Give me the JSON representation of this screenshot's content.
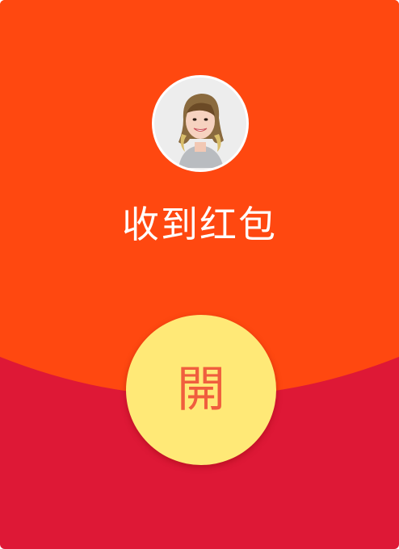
{
  "envelope": {
    "title": "收到红包",
    "open_label": "開",
    "avatar_icon": "user-avatar-photo"
  },
  "colors": {
    "flap": "#FF4810",
    "body": "#DE1836",
    "button": "#FFE977",
    "button_text": "#F05E3E",
    "title_text": "#FFFFFF"
  }
}
